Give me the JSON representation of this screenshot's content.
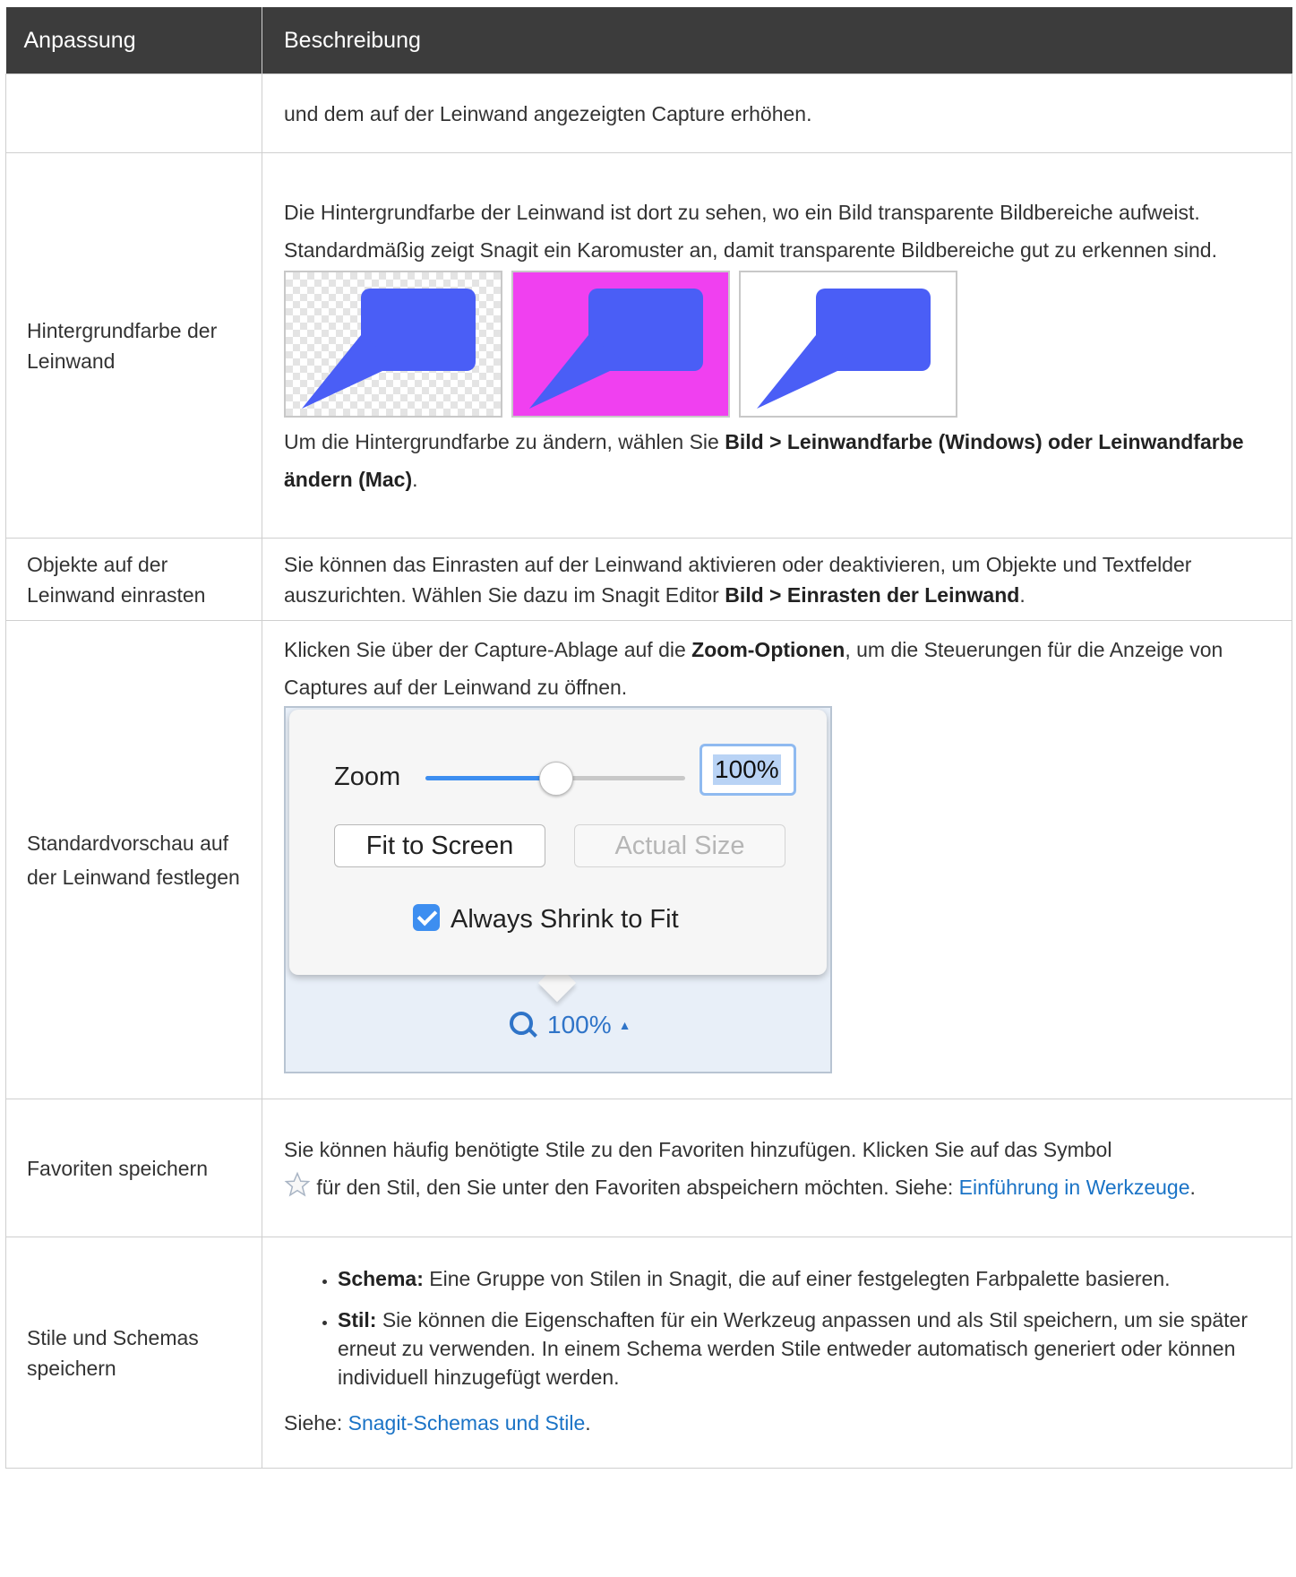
{
  "table": {
    "headers": [
      "Anpassung",
      "Beschreibung"
    ]
  },
  "rows": {
    "r0": {
      "text": "und dem auf der Leinwand angezeigten Capture erhöhen."
    },
    "r1": {
      "key": "Hintergrundfarbe der Leinwand",
      "intro": "Die Hintergrundfarbe der Leinwand ist dort zu sehen, wo ein Bild transparente Bildbereiche aufweist. Standardmäßig zeigt Snagit ein Karomuster an, damit transparente Bildbereiche gut zu erkennen sind.",
      "swatch_colors": [
        "checkerboard",
        "#f040f0",
        "#ffffff"
      ],
      "callout_color": "#4a5ef6",
      "outro_pre": "Um die Hintergrundfarbe zu ändern, wählen Sie ",
      "outro_bold": "Bild > Leinwandfarbe (Windows) oder Leinwandfarbe ändern (Mac)",
      "outro_post": "."
    },
    "r2": {
      "key": "Objekte auf der Leinwand einrasten",
      "pre": "Sie können das Einrasten auf der Leinwand aktivieren oder deaktivieren, um Objekte und Textfelder auszurichten. Wählen Sie dazu im Snagit Editor ",
      "bold": "Bild > Einrasten der Leinwand",
      "post": "."
    },
    "r3": {
      "key": "Standardvorschau auf der Leinwand festlegen",
      "pre": "Klicken Sie über der Capture-Ablage auf die ",
      "bold": "Zoom-Optionen",
      "post": ", um die Steuerungen für die Anzeige von Captures auf der Leinwand zu öffnen.",
      "zoom": {
        "label": "Zoom",
        "slider_fraction": 0.5,
        "value": "100%",
        "fit_button": "Fit to Screen",
        "actual_button": "Actual Size",
        "checkbox_label": "Always Shrink to Fit",
        "checkbox_checked": true,
        "status_value": "100%",
        "status_arrow": "▲"
      }
    },
    "r4": {
      "key": "Favoriten speichern",
      "pre": "Sie können häufig benötigte Stile zu den Favoriten hinzufügen. Klicken Sie auf das Symbol",
      "icon": "star-icon",
      "mid": " für den Stil, den Sie unter den Favoriten abspeichern möchten. Siehe: ",
      "link": "Einführung in Werkzeuge",
      "post": "."
    },
    "r5": {
      "key": "Stile und Schemas speichern",
      "items": [
        {
          "bold": "Schema:",
          "text": " Eine Gruppe von Stilen in Snagit, die auf einer festgelegten Farbpalette basieren."
        },
        {
          "bold": "Stil:",
          "text": " Sie können die Eigenschaften für ein Werkzeug anpassen und als Stil speichern, um sie später erneut zu verwenden. In einem Schema werden Stile entweder automatisch generiert oder können individuell hinzugefügt werden."
        }
      ],
      "see_pre": "Siehe: ",
      "see_link": "Snagit-Schemas und Stile",
      "see_post": "."
    }
  }
}
